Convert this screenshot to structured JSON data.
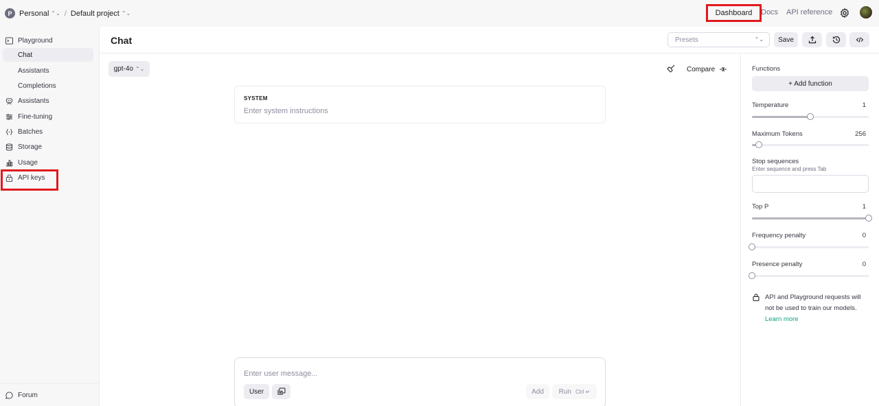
{
  "topbar": {
    "org_initial": "P",
    "org_name": "Personal",
    "project_name": "Default project",
    "links": {
      "dashboard": "Dashboard",
      "docs": "Docs",
      "api_reference": "API reference"
    }
  },
  "sidebar": {
    "playground": "Playground",
    "sub_items": [
      "Chat",
      "Assistants",
      "Completions"
    ],
    "items": [
      "Assistants",
      "Fine-tuning",
      "Batches",
      "Storage",
      "Usage",
      "API keys"
    ],
    "footer": "Forum"
  },
  "header": {
    "title": "Chat",
    "presets_placeholder": "Presets",
    "save_label": "Save"
  },
  "chat": {
    "model": "gpt-4o",
    "compare_label": "Compare",
    "system_label": "SYSTEM",
    "system_placeholder": "Enter system instructions",
    "message_placeholder": "Enter user message...",
    "role_label": "User",
    "add_label": "Add",
    "run_label": "Run",
    "run_shortcut": "Ctrl ↵"
  },
  "settings": {
    "functions_label": "Functions",
    "add_function_label": "+ Add function",
    "temperature": {
      "label": "Temperature",
      "value": "1",
      "fraction": 0.5
    },
    "max_tokens": {
      "label": "Maximum Tokens",
      "value": "256",
      "fraction": 0.06
    },
    "stop_sequences": {
      "label": "Stop sequences",
      "hint": "Enter sequence and press Tab"
    },
    "top_p": {
      "label": "Top P",
      "value": "1",
      "fraction": 1.0
    },
    "frequency_penalty": {
      "label": "Frequency penalty",
      "value": "0",
      "fraction": 0.0
    },
    "presence_penalty": {
      "label": "Presence penalty",
      "value": "0",
      "fraction": 0.0
    },
    "notice": "API and Playground requests will not be used to train our models.",
    "learn_more": "Learn more"
  }
}
